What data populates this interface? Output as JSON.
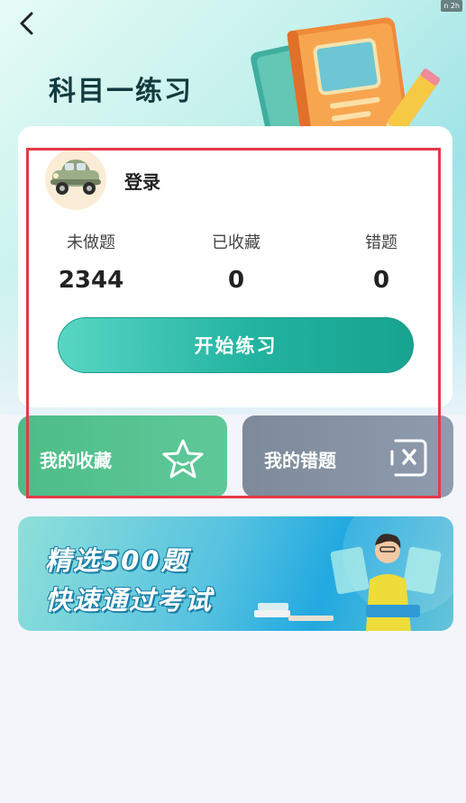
{
  "status_bar": {
    "chip": "n 2h"
  },
  "header": {
    "title": "科目一练习"
  },
  "profile": {
    "login_label": "登录",
    "avatar_icon": "vintage-car-icon"
  },
  "stats": [
    {
      "label": "未做题",
      "value": "2344"
    },
    {
      "label": "已收藏",
      "value": "0"
    },
    {
      "label": "错题",
      "value": "0"
    }
  ],
  "actions": {
    "start_label": "开始练习"
  },
  "tiles": {
    "favorites": {
      "label": "我的收藏",
      "icon": "star-icon",
      "color": "#4dbd87"
    },
    "wrong": {
      "label": "我的错题",
      "icon": "close-box-icon",
      "color": "#7d8a9a"
    }
  },
  "banner": {
    "line1": "精选500题",
    "line2": "快速通过考试"
  },
  "colors": {
    "accent": "#22b3a0",
    "highlight": "#e53945",
    "title": "#123b3f"
  }
}
